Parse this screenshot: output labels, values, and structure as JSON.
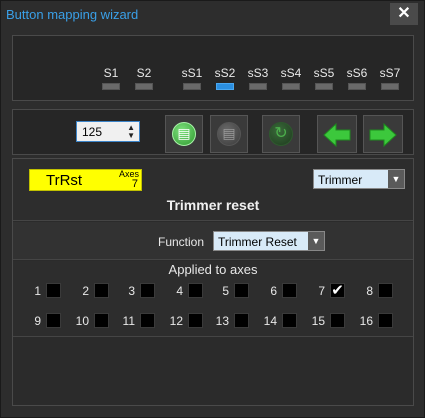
{
  "window": {
    "title": "Button mapping wizard",
    "close_glyph": "✕"
  },
  "shift_buttons": [
    {
      "label": "S1",
      "active": false
    },
    {
      "label": "S2",
      "active": false
    },
    {
      "label": "sS1",
      "active": false
    },
    {
      "label": "sS2",
      "active": true
    },
    {
      "label": "sS3",
      "active": false
    },
    {
      "label": "sS4",
      "active": false
    },
    {
      "label": "sS5",
      "active": false
    },
    {
      "label": "sS6",
      "active": false
    },
    {
      "label": "sS7",
      "active": false
    }
  ],
  "toolbar": {
    "button_number": "125",
    "spin_up": "▲",
    "spin_down": "▼",
    "icons": [
      "paste-icon",
      "copy-icon",
      "refresh-icon",
      "arrow-left-icon",
      "arrow-right-icon"
    ],
    "accent_color": "#2b8fe0",
    "arrow_color": "#3cc83c"
  },
  "mapping": {
    "short_name": "TrRst",
    "axes_label": "Axes",
    "axes_count": "7",
    "type_select": "Trimmer",
    "heading": "Trimmer reset",
    "function_label": "Function",
    "function_select": "Trimmer Reset",
    "dropdown_glyph": "▼",
    "highlight_color": "#ffff00"
  },
  "axes": {
    "title": "Applied to axes",
    "items": [
      {
        "num": "1",
        "checked": false,
        "mark": ""
      },
      {
        "num": "2",
        "checked": false,
        "mark": ""
      },
      {
        "num": "3",
        "checked": false,
        "mark": ""
      },
      {
        "num": "4",
        "checked": false,
        "mark": ""
      },
      {
        "num": "5",
        "checked": false,
        "mark": ""
      },
      {
        "num": "6",
        "checked": false,
        "mark": ""
      },
      {
        "num": "7",
        "checked": true,
        "mark": "✔"
      },
      {
        "num": "8",
        "checked": false,
        "mark": ""
      },
      {
        "num": "9",
        "checked": false,
        "mark": ""
      },
      {
        "num": "10",
        "checked": false,
        "mark": ""
      },
      {
        "num": "11",
        "checked": false,
        "mark": ""
      },
      {
        "num": "12",
        "checked": false,
        "mark": ""
      },
      {
        "num": "13",
        "checked": false,
        "mark": ""
      },
      {
        "num": "14",
        "checked": false,
        "mark": ""
      },
      {
        "num": "15",
        "checked": false,
        "mark": ""
      },
      {
        "num": "16",
        "checked": false,
        "mark": ""
      }
    ]
  }
}
